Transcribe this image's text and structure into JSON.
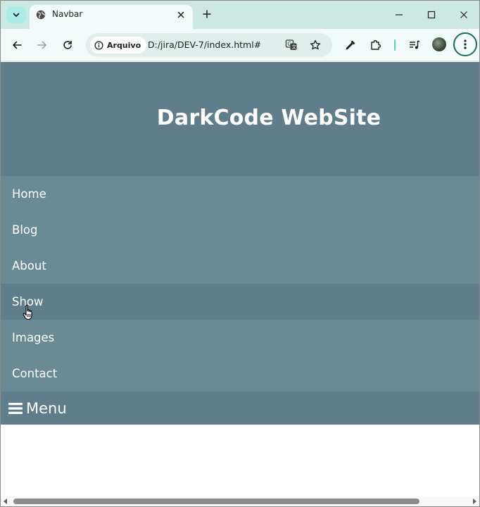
{
  "browser": {
    "tab_title": "Navbar",
    "address_chip": "Arquivo",
    "url": "D:/jira/DEV-7/index.html#"
  },
  "site": {
    "title": "DarkCode WebSite",
    "nav": {
      "items": [
        {
          "label": "Home"
        },
        {
          "label": "Blog"
        },
        {
          "label": "About"
        },
        {
          "label": "Show",
          "hovered": true
        },
        {
          "label": "Images"
        },
        {
          "label": "Contact"
        }
      ],
      "menu_label": "Menu",
      "menu_icon": "hamburger-icon"
    }
  },
  "colors": {
    "header_bg": "#607d8b",
    "nav_item_bg": "#6a8a96",
    "nav_item_hover_bg": "#607d8b",
    "text": "#ffffff",
    "tabbar_bg": "#cde8e2",
    "toolbar_bg": "#f2fbf9"
  }
}
